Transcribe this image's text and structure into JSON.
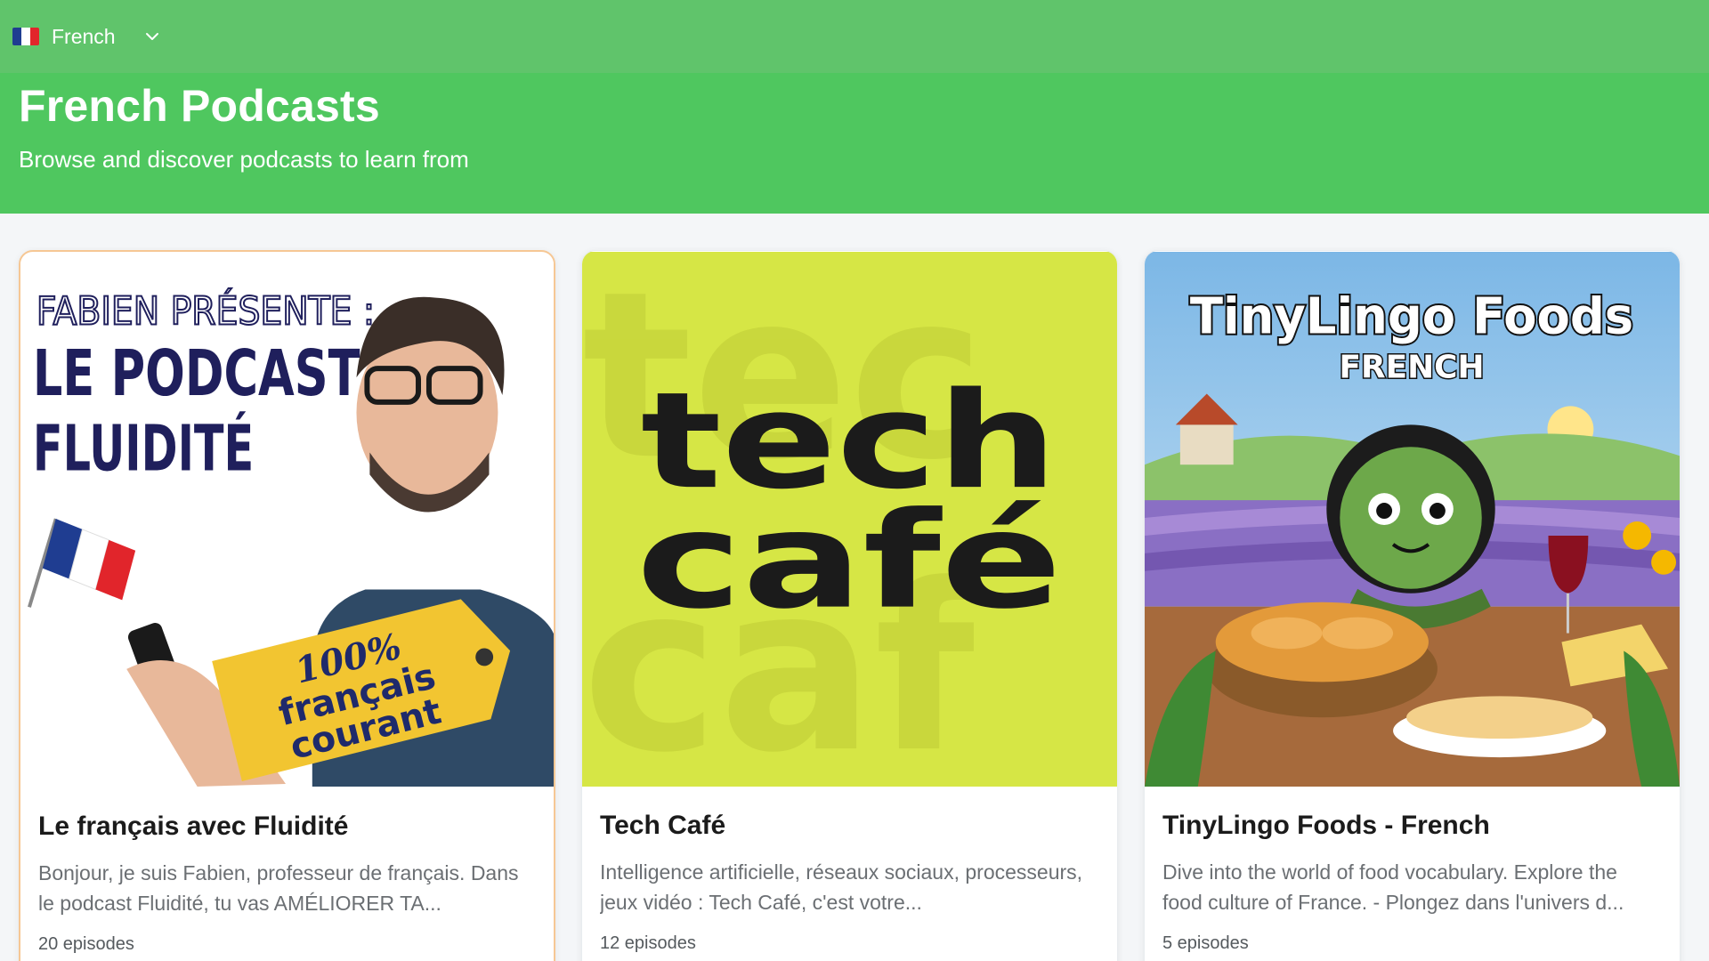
{
  "header": {
    "language_label": "French",
    "flag_colors": [
      "#1f3d91",
      "#ffffff",
      "#e1252b"
    ]
  },
  "hero": {
    "title": "French Podcasts",
    "subtitle": "Browse and discover podcasts to learn from"
  },
  "colors": {
    "topbar": "#60c46b",
    "hero": "#4fc75f",
    "tech_cafe_bg": "#d6e645"
  },
  "podcasts": [
    {
      "title": "Le français avec Fluidité",
      "description": "Bonjour, je suis Fabien, professeur de français. Dans le podcast Fluidité, tu vas AMÉLIORER TA...",
      "episodes": "20 episodes",
      "cover": {
        "line1": "FABIEN PRÉSENTE :",
        "line2": "LE PODCAST",
        "line3": "FLUIDITÉ",
        "tag1": "100%",
        "tag2": "français",
        "tag3": "courant"
      }
    },
    {
      "title": "Tech Café",
      "description": "Intelligence artificielle, réseaux sociaux, processeurs, jeux vidéo : Tech Café, c'est votre...",
      "episodes": "12 episodes",
      "cover": {
        "line1": "tech",
        "line2": "café"
      }
    },
    {
      "title": "TinyLingo Foods - French",
      "description": "Dive into the world of food vocabulary. Explore the food culture of France. - Plongez dans l'univers d...",
      "episodes": "5 episodes",
      "cover": {
        "line1": "TinyLingo Foods",
        "line2": "FRENCH"
      }
    }
  ]
}
